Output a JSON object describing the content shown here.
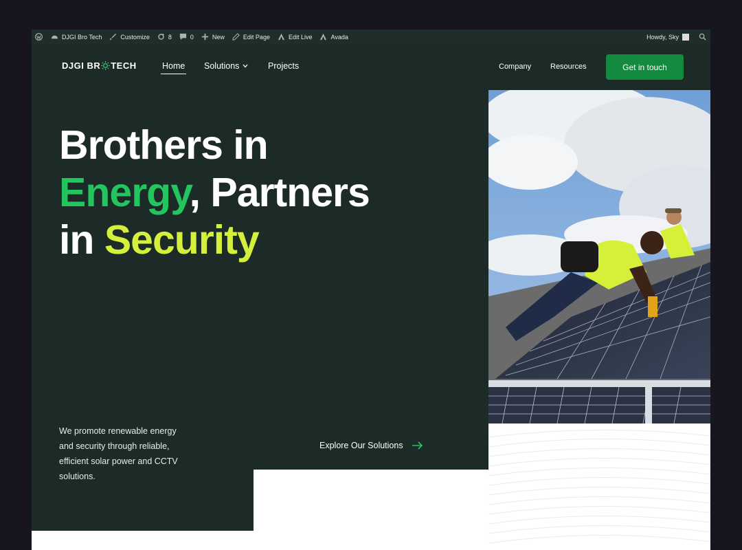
{
  "admin_bar": {
    "site_name": "DJGI Bro Tech",
    "customize": "Customize",
    "updates": "8",
    "comments": "0",
    "new": "New",
    "edit_page": "Edit Page",
    "edit_live": "Edit Live",
    "avada": "Avada",
    "howdy": "Howdy, Sky"
  },
  "header": {
    "logo_left": "DJGI BR",
    "logo_right": "TECH",
    "nav": {
      "home": "Home",
      "solutions": "Solutions",
      "projects": "Projects",
      "company": "Company",
      "resources": "Resources"
    },
    "cta": "Get in touch"
  },
  "hero": {
    "line1": "Brothers in",
    "energy": "Energy",
    "line2_rest": ", Partners",
    "line3_prefix": "in ",
    "security": "Security",
    "description": "We promote renewable energy and security through reliable, efficient solar power and CCTV solutions.",
    "explore": "Explore Our Solutions"
  },
  "colors": {
    "dark_green": "#1c2b27",
    "accent_green": "#22c55e",
    "accent_lime": "#d4f03c",
    "button_green": "#148a3f"
  },
  "icons": [
    "wordpress-icon",
    "dashboard-icon",
    "brush-icon",
    "refresh-icon",
    "comment-icon",
    "plus-icon",
    "pencil-icon",
    "avada-icon",
    "search-icon",
    "chevron-down-icon",
    "arrow-right-icon"
  ]
}
